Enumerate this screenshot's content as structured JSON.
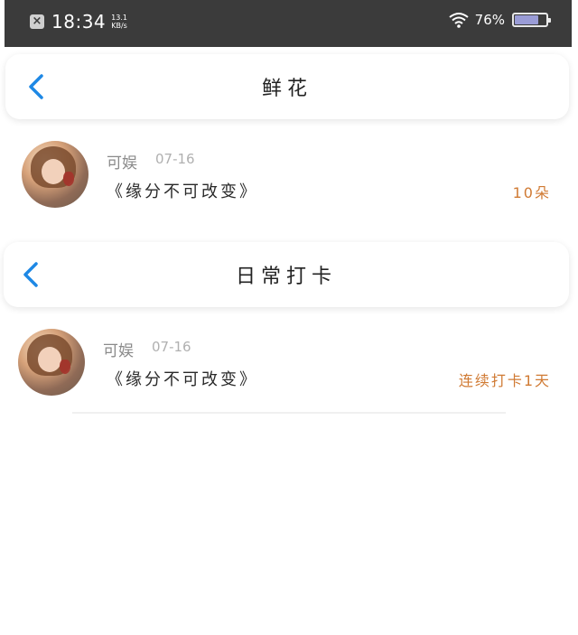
{
  "status_bar": {
    "time": "18:34",
    "net_speed_value": "13.1",
    "net_speed_unit": "KB/s",
    "battery_pct": "76%",
    "battery_level": 0.76
  },
  "sections": [
    {
      "title": "鲜花",
      "item": {
        "username": "可娱",
        "date": "07-16",
        "message": "《缘分不可改变》",
        "meta": "10朵"
      }
    },
    {
      "title": "日常打卡",
      "item": {
        "username": "可娱",
        "date": "07-16",
        "message": "《缘分不可改变》",
        "meta": "连续打卡1天"
      }
    }
  ],
  "colors": {
    "accent_blue": "#1e88e5",
    "meta_orange": "#d07a33"
  }
}
